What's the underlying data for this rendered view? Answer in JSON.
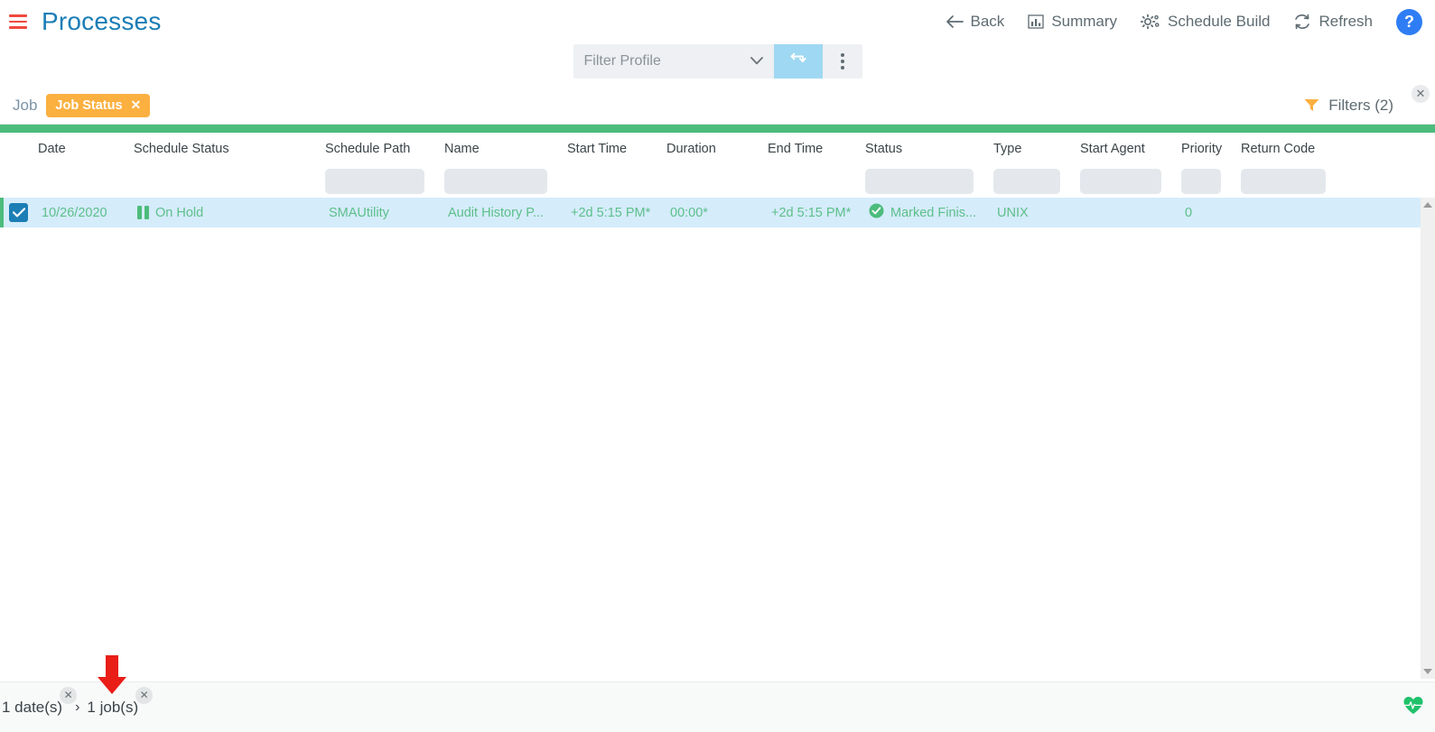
{
  "header": {
    "menu_icon": "hamburger-icon",
    "title": "Processes",
    "actions": [
      {
        "label": "Back",
        "icon": "arrow-left-icon"
      },
      {
        "label": "Summary",
        "icon": "bar-chart-icon"
      },
      {
        "label": "Schedule Build",
        "icon": "gears-icon"
      },
      {
        "label": "Refresh",
        "icon": "refresh-icon"
      }
    ],
    "help_label": "?"
  },
  "profile_bar": {
    "select_placeholder": "Filter Profile",
    "select_value": "",
    "caret_icon": "chevron-down-icon",
    "swap_icon": "swap-refresh-icon",
    "more_icon": "vertical-dots-icon"
  },
  "filter_chips": {
    "group_label": "Job",
    "chips": [
      {
        "label": "Job Status",
        "remove": "✕"
      }
    ],
    "filters_label": "Filters (2)",
    "funnel_icon": "funnel-icon",
    "close_icon": "✕"
  },
  "table": {
    "columns": [
      "Date",
      "Schedule Status",
      "Schedule Path",
      "Name",
      "Start Time",
      "Duration",
      "End Time",
      "Status",
      "Type",
      "Start Agent",
      "Priority",
      "Return Code"
    ],
    "column_filters": [
      false,
      false,
      true,
      true,
      false,
      false,
      false,
      true,
      true,
      true,
      true,
      true
    ],
    "rows": [
      {
        "selected": true,
        "date": "10/26/2020",
        "schedule_status": "On Hold",
        "schedule_status_icon": "pause-icon",
        "schedule_path": "SMAUtility",
        "name": "Audit History P...",
        "start_time": "+2d 5:15 PM*",
        "duration": "00:00*",
        "end_time": "+2d 5:15 PM*",
        "status": "Marked Finis...",
        "status_icon": "check-circle-icon",
        "type": "UNIX",
        "start_agent": "",
        "priority": "0",
        "return_code": ""
      }
    ]
  },
  "scrollbar": {
    "up_icon": "triangle-up-icon",
    "down_icon": "triangle-down-icon"
  },
  "status_bar": {
    "crumb_dates": "1 date(s)",
    "crumb_dates_close": "✕",
    "separator": "›",
    "crumb_jobs": "1 job(s)",
    "crumb_jobs_close": "✕",
    "health_icon": "heartbeat-icon"
  },
  "annotation": {
    "arrow_icon": "red-down-arrow-annotation",
    "color": "#e81e17"
  },
  "colors": {
    "title": "#1a7db6",
    "accent_green": "#4cbc7c",
    "row_bg": "#d5ecfb",
    "row_text": "#5cbf8a",
    "chip_orange": "#fbb040",
    "checkbox_blue": "#1b7fb5",
    "help_blue": "#2f7df4",
    "hamburger_red": "#f0483e"
  }
}
